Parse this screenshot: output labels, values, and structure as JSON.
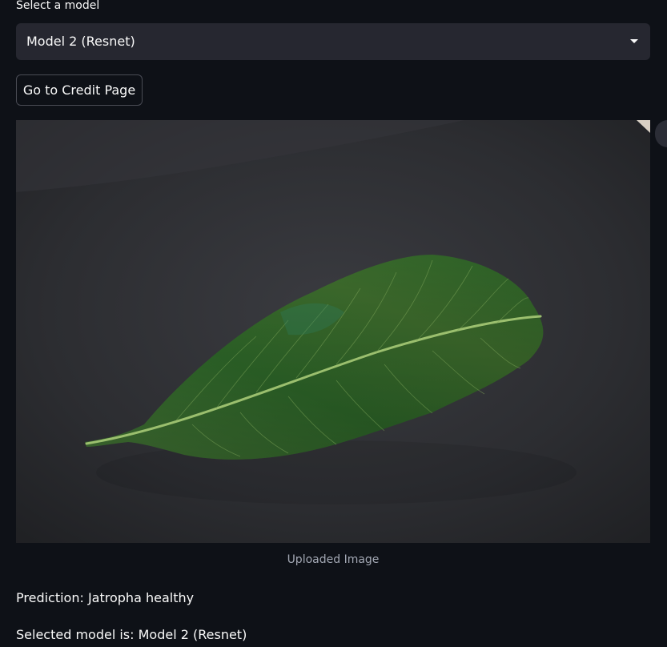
{
  "select": {
    "label": "Select a model",
    "value": "Model 2 (Resnet)"
  },
  "credit_button": {
    "label": "Go to Credit Page"
  },
  "image": {
    "caption": "Uploaded Image"
  },
  "results": {
    "prediction": "Prediction: Jatropha healthy",
    "selected_model": "Selected model is: Model 2 (Resnet)"
  },
  "colors": {
    "background": "#0e1117",
    "select_bg": "#262730",
    "text": "#fafafa",
    "caption": "#a3a8b4",
    "leaf": "#2f6a2a"
  }
}
